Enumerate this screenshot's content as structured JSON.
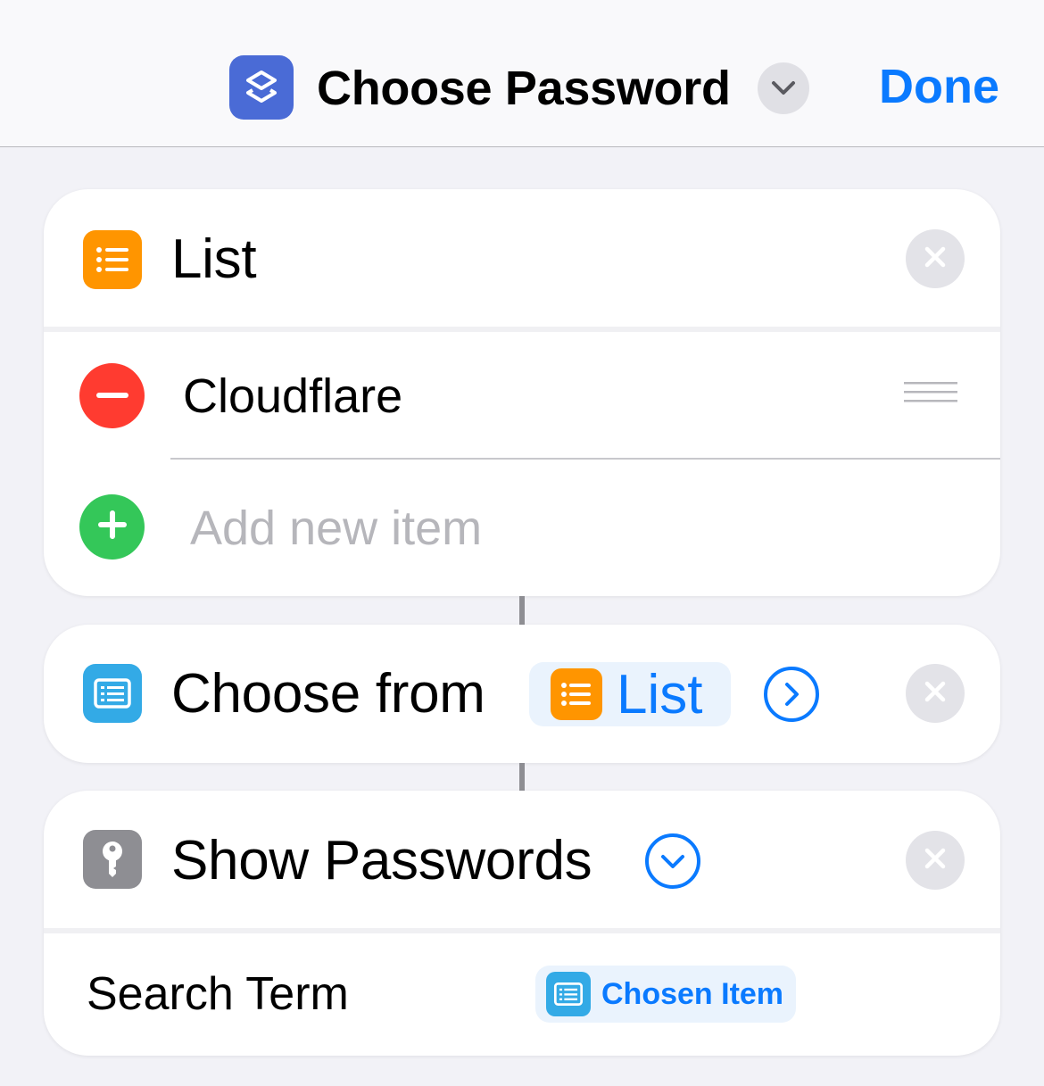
{
  "header": {
    "title": "Choose Password",
    "done_label": "Done",
    "app_icon": "shortcuts-icon",
    "chevron_icon": "chevron-down-icon"
  },
  "colors": {
    "accent": "#0a7aff",
    "list_orange": "#ff9500",
    "choose_blue": "#33aae6",
    "passwords_gray": "#8e8e93",
    "remove_red": "#ff3b30",
    "add_green": "#34c759"
  },
  "list_action": {
    "title": "List",
    "items": [
      {
        "label": "Cloudflare"
      }
    ],
    "add_placeholder": "Add new item"
  },
  "choose_action": {
    "title": "Choose from",
    "token_label": "List"
  },
  "passwords_action": {
    "title": "Show Passwords",
    "param_label": "Search Term",
    "token_label": "Chosen Item"
  }
}
